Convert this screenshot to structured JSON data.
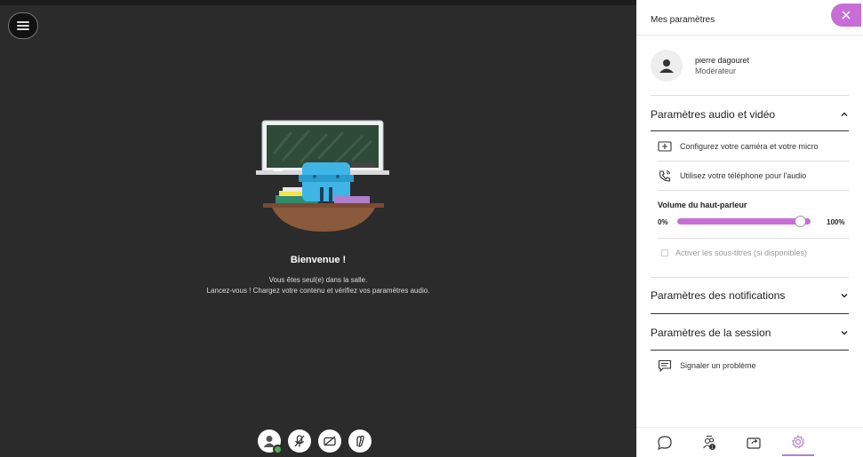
{
  "panel": {
    "title": "Mes paramètres",
    "user": {
      "name": "pierre dagouret",
      "role": "Modérateur"
    },
    "audio_video": {
      "heading": "Paramètres audio et vidéo",
      "configure_label": "Configurez votre caméra et votre micro",
      "phone_label": "Utilisez votre téléphone pour l'audio",
      "volume_label": "Volume du haut-parleur",
      "volume_min": "0%",
      "volume_max": "100%",
      "volume_level": 0.92,
      "captions_label": "Activer les sous-titres (si disponibles)"
    },
    "notifications_heading": "Paramètres des notifications",
    "session_heading": "Paramètres de la session",
    "report_label": "Signaler un problème"
  },
  "stage": {
    "welcome_title": "Bienvenue !",
    "welcome_line1": "Vous êtes seul(e) dans la salle.",
    "welcome_line2": "Lancez-vous ! Chargez votre contenu et vérifiez vos paramètres audio."
  },
  "tabs": {
    "attendees_badge": "1"
  },
  "colors": {
    "accent": "#c86dd7",
    "stage_bg": "#2b2b2b",
    "status_ok": "#4caf50"
  },
  "icons": [
    "menu-icon",
    "avatar-icon",
    "mic-off-icon",
    "camera-off-icon",
    "hand-raise-icon",
    "camera-config-icon",
    "phone-icon",
    "report-icon",
    "chat-icon",
    "attendees-icon",
    "share-icon",
    "settings-icon",
    "close-icon",
    "chevron-up-icon",
    "chevron-down-icon"
  ]
}
